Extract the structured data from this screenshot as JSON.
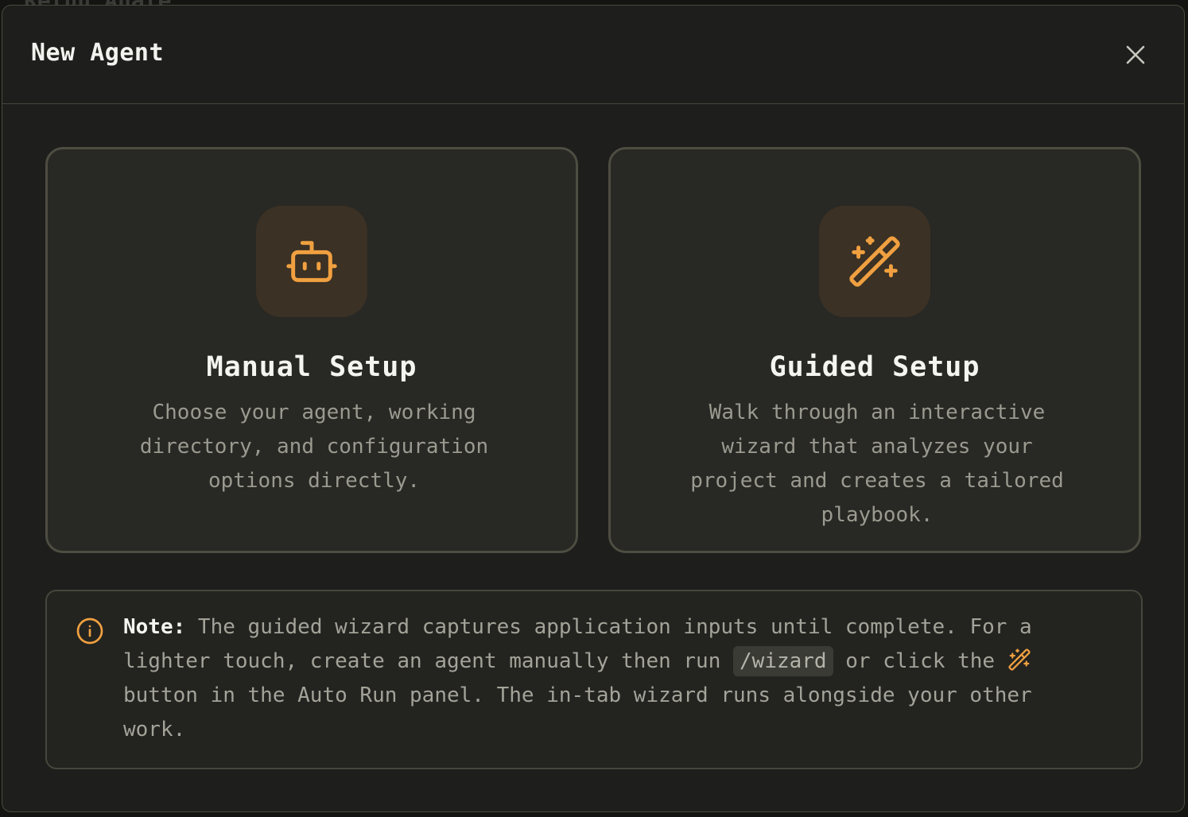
{
  "background": {
    "ghost_text": "Reluu Anale"
  },
  "dialog": {
    "title": "New Agent",
    "close_icon": "close-icon"
  },
  "options": [
    {
      "icon": "bot-icon",
      "title": "Manual Setup",
      "description": "Choose your agent, working directory, and configuration options directly."
    },
    {
      "icon": "magic-wand-icon",
      "title": "Guided Setup",
      "description": "Walk through an interactive wizard that analyzes your project and creates a tailored playbook."
    }
  ],
  "note": {
    "icon": "info-icon",
    "label": "Note:",
    "text_part1": " The guided wizard captures application inputs until complete. For a lighter touch, create an agent manually then run ",
    "command": "/wizard",
    "text_part2": " or click the ",
    "inline_icon": "magic-wand-icon",
    "text_part3": " button in the Auto Run panel. The in-tab wizard runs alongside your other work."
  },
  "colors": {
    "accent": "#f0a040",
    "background": "#1e1e1c",
    "card": "#282824",
    "border": "#4d4d42",
    "text": "#f4f4f0",
    "muted_text": "#9a9a90"
  }
}
